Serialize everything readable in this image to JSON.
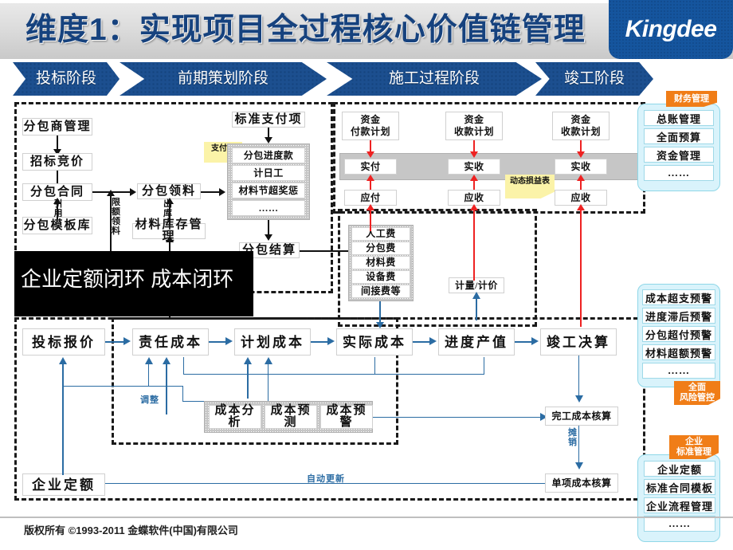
{
  "header": {
    "title": "维度1：实现项目全过程核心价值链管理",
    "logo": "Kingdee",
    "accent": "#15559e",
    "band_color": "#dcdcdc"
  },
  "stages": [
    {
      "label": "投标阶段"
    },
    {
      "label": "前期策划阶段"
    },
    {
      "label": "施工过程阶段"
    },
    {
      "label": "竣工阶段"
    }
  ],
  "subcontract": {
    "items": [
      "分包商管理",
      "招标竞价",
      "分包合同",
      "分包模板库"
    ],
    "ref_label": "引用",
    "quota_label": "限额领料",
    "pick": "分包领料",
    "pick_note": "出库",
    "inventory": "材料库存管理",
    "settle": "分包结算"
  },
  "payment": {
    "std_item": "标准支付项",
    "sticky": "支付项",
    "items": [
      "分包进度款",
      "计日工",
      "材料节超奖惩",
      "……"
    ]
  },
  "cost_items": [
    "人工费",
    "分包费",
    "材料费",
    "设备费",
    "间接费等"
  ],
  "measure": "计量/计价",
  "finance": {
    "columns": [
      {
        "plan": "资金\n付款计划",
        "actual": "实付",
        "due": "应付"
      },
      {
        "plan": "资金\n收款计划",
        "actual": "实收",
        "due": "应收"
      },
      {
        "plan": "资金\n收款计划",
        "actual": "实收",
        "due": "应收"
      }
    ],
    "plan_line1": "资金",
    "plan_pay": "付款计划",
    "plan_recv": "收款计划",
    "actual_pay": "实付",
    "actual_recv": "实收",
    "due_pay": "应付",
    "due_recv": "应收",
    "sticky": "动态损益表"
  },
  "main_flow": [
    {
      "label": "投标报价"
    },
    {
      "label": "责任成本"
    },
    {
      "label": "计划成本"
    },
    {
      "label": "实际成本"
    },
    {
      "label": "进度产值"
    },
    {
      "label": "竣工决算"
    }
  ],
  "analysis": {
    "items": [
      "成本分析",
      "成本预测",
      "成本预警"
    ],
    "adjust_label": "调整"
  },
  "right_flow": {
    "complete_cost": "完工成本核算",
    "amortize_label": "摊销",
    "single_cost": "单项成本核算"
  },
  "bottom": {
    "quota": "企业定额",
    "auto_update": "自动更新"
  },
  "artifact": {
    "text": "企业定额闭环     成本闭环"
  },
  "side_panels": [
    {
      "tag": "财务管理",
      "items": [
        "总账管理",
        "全面预算",
        "资金管理",
        "……"
      ]
    },
    {
      "tag": "全面\n风险管控",
      "tag_l1": "全面",
      "tag_l2": "风险管控",
      "items": [
        "成本超支预警",
        "进度滞后预警",
        "分包超付预警",
        "材料超额预警",
        "……"
      ]
    },
    {
      "tag_l1": "企业",
      "tag_l2": "标准管理",
      "items": [
        "企业定额",
        "标准合同模板",
        "企业流程管理",
        "……"
      ]
    }
  ],
  "footer": {
    "copyright": "版权所有 ©1993-2011 金蝶软件(中国)有限公司"
  }
}
